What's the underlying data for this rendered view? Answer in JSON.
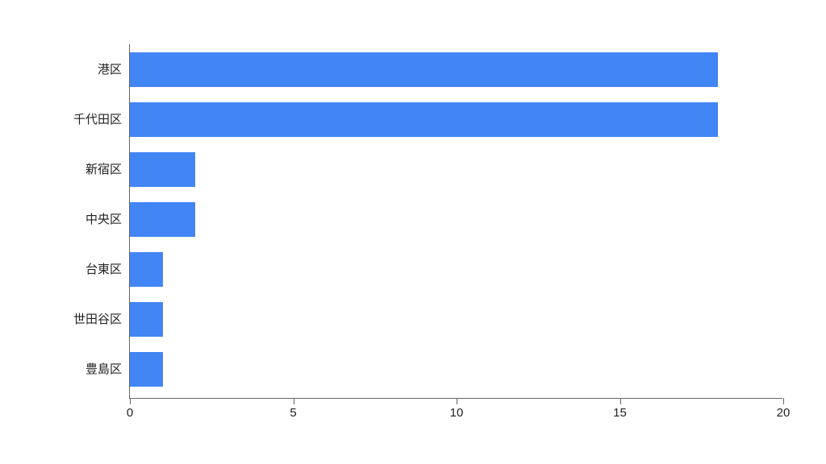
{
  "chart_data": {
    "type": "bar",
    "orientation": "horizontal",
    "categories": [
      "港区",
      "千代田区",
      "新宿区",
      "中央区",
      "台東区",
      "世田谷区",
      "豊島区"
    ],
    "values": [
      18,
      18,
      2,
      2,
      1,
      1,
      1
    ],
    "title": "",
    "xlabel": "",
    "ylabel": "",
    "xlim": [
      0,
      20
    ],
    "x_ticks": [
      0,
      5,
      10,
      15,
      20
    ],
    "bar_color": "#4285f4"
  }
}
